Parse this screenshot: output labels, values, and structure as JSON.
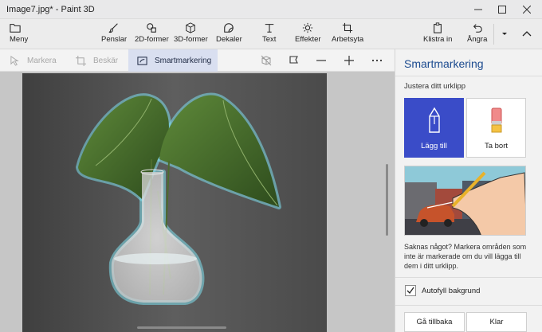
{
  "window": {
    "title": "Image7.jpg* - Paint 3D"
  },
  "ribbon": {
    "menu_label": "Meny",
    "tools": [
      {
        "label": "Penslar",
        "icon": "brush-icon"
      },
      {
        "label": "2D-former",
        "icon": "shapes-2d-icon"
      },
      {
        "label": "3D-former",
        "icon": "cube-icon"
      },
      {
        "label": "Dekaler",
        "icon": "sticker-icon"
      },
      {
        "label": "Text",
        "icon": "text-icon"
      },
      {
        "label": "Effekter",
        "icon": "sun-icon"
      },
      {
        "label": "Arbetsyta",
        "icon": "canvas-crop-icon"
      }
    ],
    "paste_label": "Klistra in",
    "undo_label": "Ångra"
  },
  "toolbar": {
    "select_label": "Markera",
    "crop_label": "Beskär",
    "magic_select_label": "Smartmarkering"
  },
  "panel": {
    "title": "Smartmarkering",
    "subtitle": "Justera ditt urklipp",
    "add_label": "Lägg till",
    "remove_label": "Ta bort",
    "help_text": "Saknas något? Markera områden som inte är markerade om du vill lägga till dem i ditt urklipp.",
    "autofill_label": "Autofyll bakgrund",
    "autofill_checked": true,
    "back_label": "Gå tillbaka",
    "done_label": "Klar"
  },
  "colors": {
    "accent": "#3a4cc8",
    "panel_title": "#1b4a8f",
    "selection_glow": "#7fe0ee"
  }
}
